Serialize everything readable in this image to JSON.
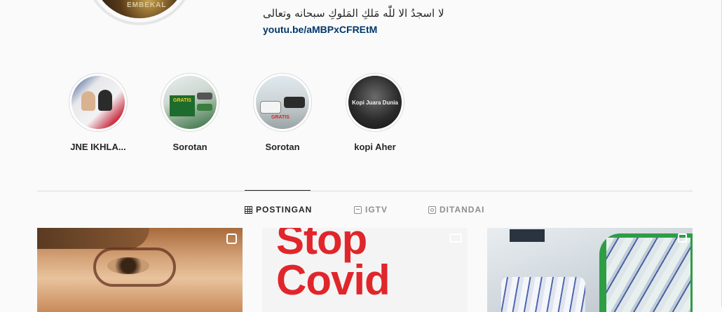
{
  "profile": {
    "avatar_text": "EMBEKAL",
    "bio_line": "لا اسجدُ الا للّٰه مَلكِ المَلوكِ سبحانه وتعالى",
    "bio_link": "youtu.be/aMBPxCFREtM"
  },
  "highlights": [
    {
      "label": "JNE IKHLA...",
      "icon": "highlight-cover",
      "inner_text": ""
    },
    {
      "label": "Sorotan",
      "icon": "highlight-cover",
      "inner_text": "GRATIS"
    },
    {
      "label": "Sorotan",
      "icon": "highlight-cover",
      "inner_text": "GRATIS"
    },
    {
      "label": "kopi Aher",
      "icon": "highlight-cover",
      "inner_text": "Kopi Juara Dunia"
    }
  ],
  "tabs": [
    {
      "label": "POSTINGAN",
      "icon": "grid-icon",
      "active": true
    },
    {
      "label": "IGTV",
      "icon": "igtv-icon",
      "active": false
    },
    {
      "label": "DITANDAI",
      "icon": "tagged-icon",
      "active": false
    }
  ],
  "posts": [
    {
      "type": "igtv",
      "badge_icon": "igtv-badge-icon",
      "text": ""
    },
    {
      "type": "video",
      "badge_icon": "video-badge-icon",
      "text_line1": "Stop",
      "text_line2": "Covid"
    },
    {
      "type": "multi",
      "badge_icon": "carousel-badge-icon",
      "text": ""
    }
  ],
  "colors": {
    "background": "#fafafa",
    "text": "#262626",
    "link": "#00376b",
    "muted": "#8e8e8e",
    "divider": "#dbdbdb"
  }
}
